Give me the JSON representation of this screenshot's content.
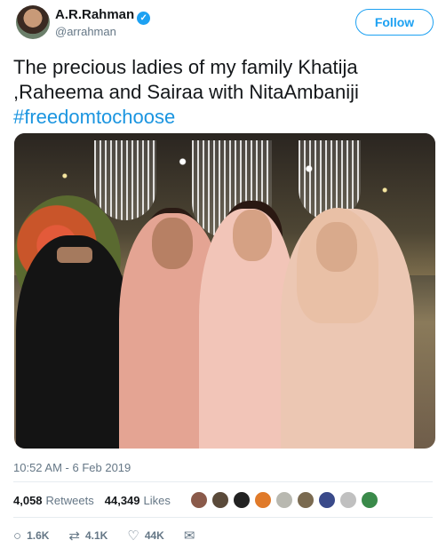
{
  "user": {
    "name": "A.R.Rahman",
    "handle": "@arrahman",
    "verified_icon": "✓",
    "follow_label": "Follow"
  },
  "tweet": {
    "text": "The precious ladies of my family Khatija ,Raheema and Sairaa with NitaAmbaniji",
    "hashtag": "#freedomtochoose",
    "timestamp": "10:52 AM - 6 Feb 2019"
  },
  "stats": {
    "retweets_count": "4,058",
    "retweets_label": "Retweets",
    "likes_count": "44,349",
    "likes_label": "Likes"
  },
  "likers": [
    {
      "color": "#8a5a4a"
    },
    {
      "color": "#5a4a3a"
    },
    {
      "color": "#222222"
    },
    {
      "color": "#e07a2a"
    },
    {
      "color": "#b8b8b0"
    },
    {
      "color": "#7a6a50"
    },
    {
      "color": "#3a4a8a"
    },
    {
      "color": "#c0c0c0"
    },
    {
      "color": "#3a8a4a"
    }
  ],
  "actions": {
    "reply_icon": "○",
    "reply_count": "1.6K",
    "retweet_icon": "⇄",
    "retweet_count": "4.1K",
    "like_icon": "♡",
    "like_count": "44K",
    "message_icon": "✉"
  },
  "colors": {
    "accent": "#1da1f2",
    "hashtag": "#1b95e0",
    "muted": "#657786"
  }
}
